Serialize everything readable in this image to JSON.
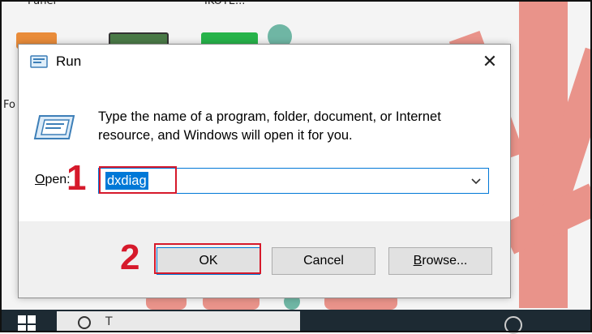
{
  "desktop": {
    "labels": [
      "Panel",
      "IKOTE..."
    ],
    "side_char": "Fo"
  },
  "dialog": {
    "title": "Run",
    "close_glyph": "✕",
    "description": "Type the name of a program, folder, document, or Internet resource, and Windows will open it for you.",
    "open_label_accel": "O",
    "open_label_rest": "pen:",
    "open_value": "dxdiag",
    "buttons": {
      "ok": "OK",
      "cancel": "Cancel",
      "browse_accel": "B",
      "browse_rest": "rowse..."
    }
  },
  "annotations": {
    "step1": "1",
    "step2": "2"
  },
  "taskbar": {
    "search_hint": "T"
  },
  "colors": {
    "accent": "#0078d7",
    "annotation": "#d6192b",
    "wallpaper_coral": "#e9938a",
    "wallpaper_teal": "#6fb6a4"
  },
  "icons": [
    "run-app-icon",
    "run-body-icon",
    "close-icon",
    "chevron-down-icon",
    "windows-logo-icon"
  ]
}
